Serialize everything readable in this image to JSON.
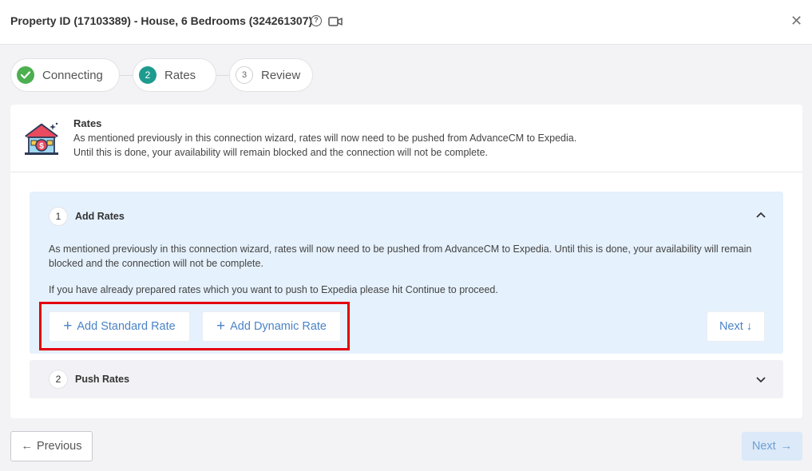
{
  "header": {
    "title": "Property ID (17103389) - House, 6 Bedrooms (324261307)",
    "help_icon": "question-circle-icon",
    "video_icon": "video-camera-icon",
    "close_icon": "close-icon",
    "close_glyph": "✕"
  },
  "steps": [
    {
      "number": "✓",
      "label": "Connecting",
      "state": "done"
    },
    {
      "number": "2",
      "label": "Rates",
      "state": "active"
    },
    {
      "number": "3",
      "label": "Review",
      "state": "pending"
    }
  ],
  "intro": {
    "icon": "house-money-icon",
    "title": "Rates",
    "line1": "As mentioned previously in this connection wizard, rates will now need to be pushed from AdvanceCM to Expedia.",
    "line2": "Until this is done, your availability will remain blocked and the connection will not be complete."
  },
  "accordion": {
    "add_rates": {
      "number": "1",
      "title": "Add Rates",
      "chevron": "^",
      "paragraph1": "As mentioned previously in this connection wizard, rates will now need to be pushed from AdvanceCM to Expedia. Until this is done, your availability will remain blocked and the connection will not be complete.",
      "paragraph2": "If you have already prepared rates which you want to push to Expedia please hit Continue to proceed.",
      "add_standard_label": "Add Standard Rate",
      "add_dynamic_label": "Add Dynamic Rate",
      "plus_glyph": "+",
      "next_label": "Next",
      "next_arrow": "↓"
    },
    "push_rates": {
      "number": "2",
      "title": "Push Rates",
      "chevron": "⌄"
    }
  },
  "footer": {
    "previous_label": "Previous",
    "previous_arrow": "←",
    "next_label": "Next",
    "next_arrow": "→"
  },
  "colors": {
    "accent_teal": "#1e9b8f",
    "done_green": "#4caf50",
    "link_blue": "#4a83c6",
    "highlight_red": "#e3000f",
    "panel_blue": "#e5f1fc"
  }
}
